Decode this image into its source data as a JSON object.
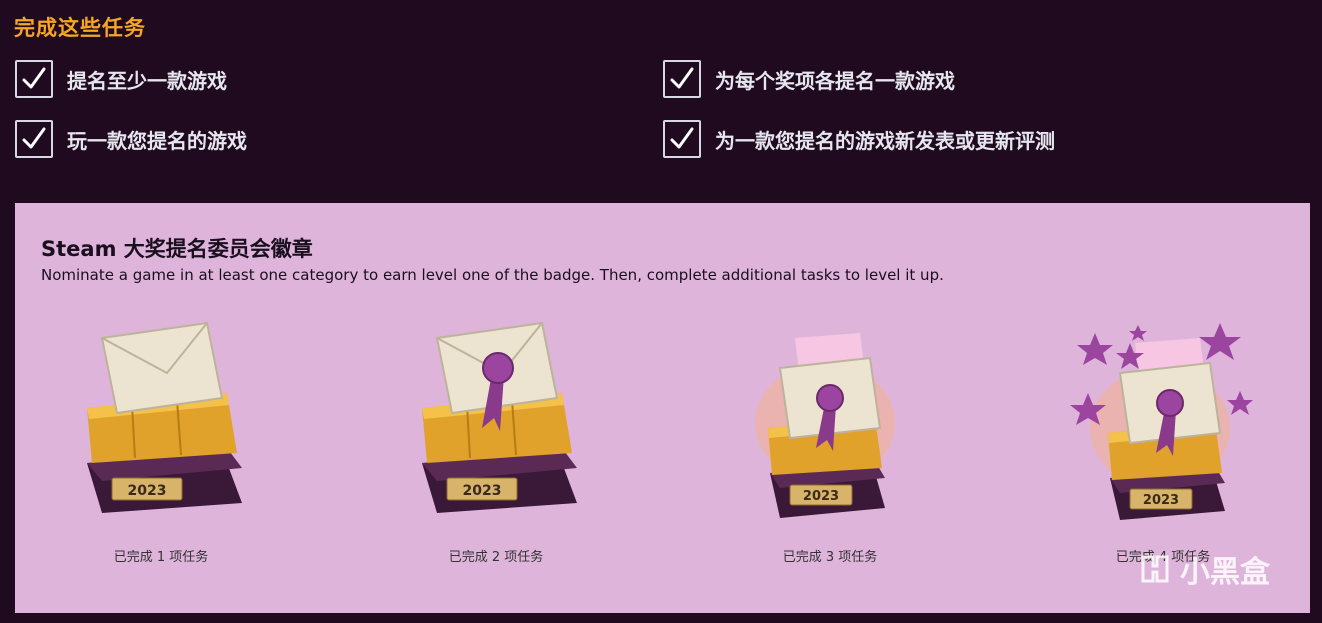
{
  "tasks_section": {
    "title": "完成这些任务",
    "tasks": [
      {
        "label": "提名至少一款游戏",
        "checked": true
      },
      {
        "label": "为每个奖项各提名一款游戏",
        "checked": true
      },
      {
        "label": "玩一款您提名的游戏",
        "checked": true
      },
      {
        "label": "为一款您提名的游戏新发表或更新评测",
        "checked": true
      }
    ]
  },
  "badge_panel": {
    "title": "Steam 大奖提名委员会徽章",
    "description": "Nominate a game in at least one category to earn level one of the badge. Then, complete additional tasks to level it up.",
    "badges": [
      {
        "year": "2023",
        "caption": "已完成 1 项任务",
        "level": 1
      },
      {
        "year": "2023",
        "caption": "已完成 2 项任务",
        "level": 2
      },
      {
        "year": "2023",
        "caption": "已完成 3 项任务",
        "level": 3
      },
      {
        "year": "2023",
        "caption": "已完成 4 项任务",
        "level": 4
      }
    ]
  },
  "watermark": {
    "text": "小黑盒"
  },
  "colors": {
    "background": "#200a1f",
    "accent": "#f5a623",
    "panel": "#dfb4db",
    "gold": "#e0a22a",
    "purple": "#8a3a8a"
  }
}
